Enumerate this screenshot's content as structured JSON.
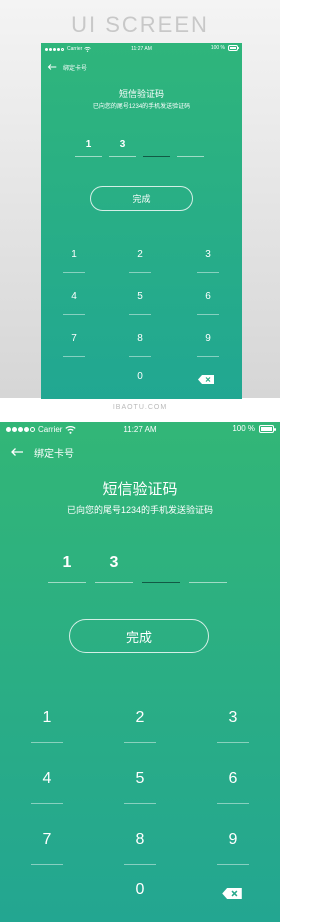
{
  "showcase": {
    "heading": "UI SCREEN",
    "watermark": "IBAOTU.COM"
  },
  "status_bar": {
    "carrier": "Carrier",
    "time": "11:27 AM",
    "battery": "100 %"
  },
  "nav": {
    "title": "绑定卡号"
  },
  "verify": {
    "title": "短信验证码",
    "subtitle": "已向您的尾号1234的手机发送验证码",
    "code": [
      "1",
      "3",
      "",
      ""
    ]
  },
  "done_label": "完成",
  "keypad": {
    "keys": [
      "1",
      "2",
      "3",
      "4",
      "5",
      "6",
      "7",
      "8",
      "9",
      "0"
    ]
  },
  "colors": {
    "gradient_top": "#32b677",
    "gradient_bottom": "#23a691",
    "text": "#ffffff"
  }
}
